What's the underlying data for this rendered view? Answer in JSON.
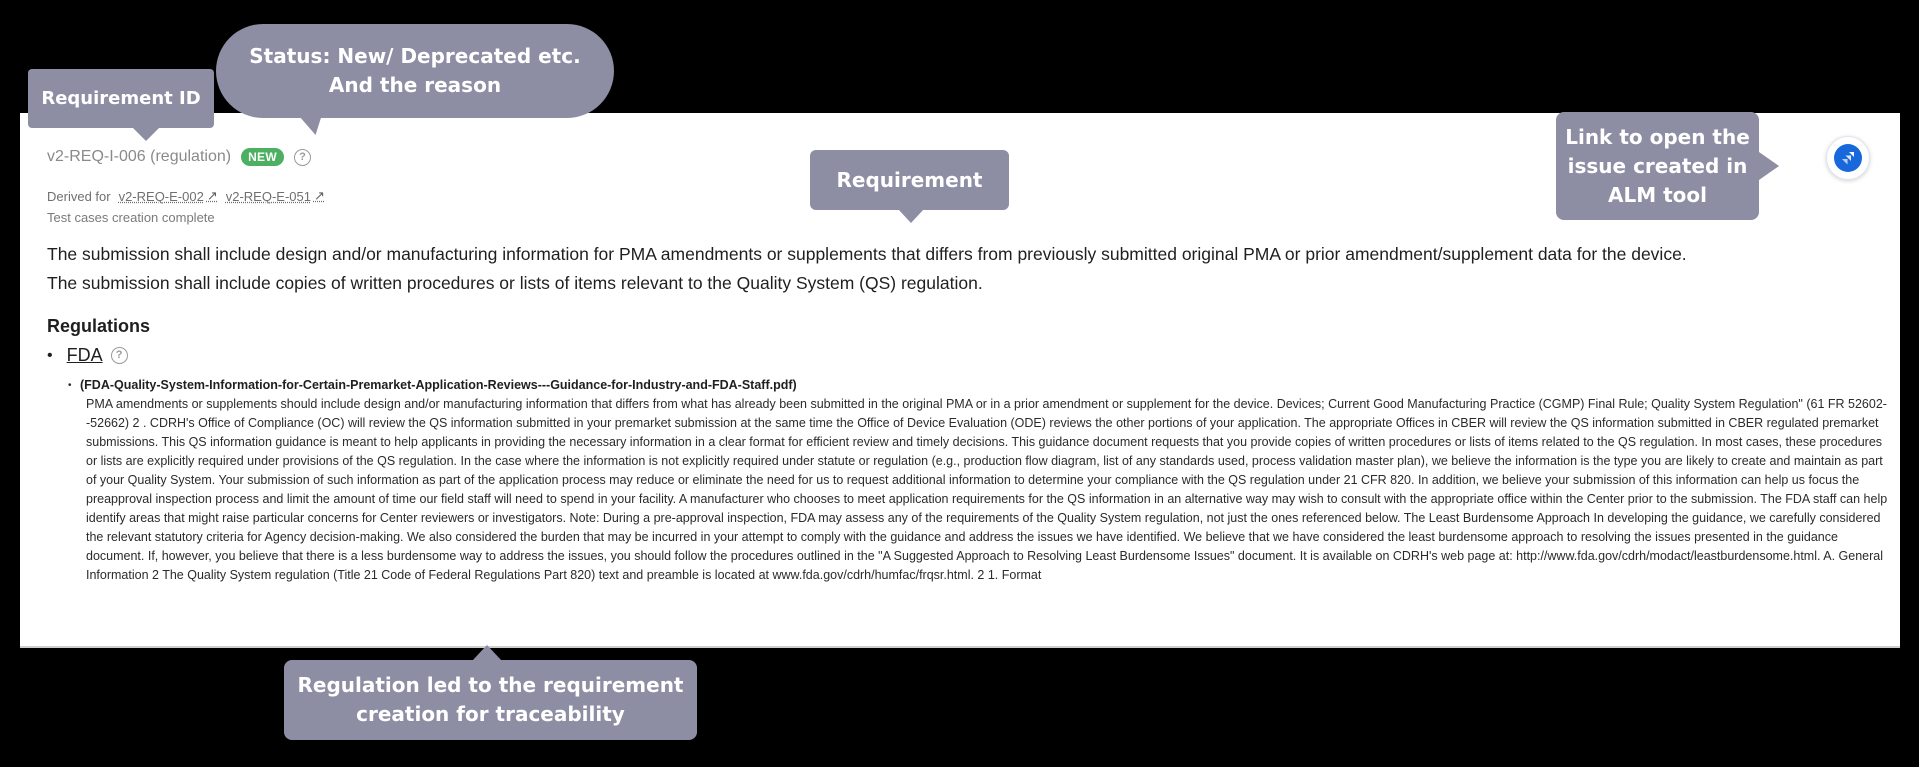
{
  "requirement": {
    "id_label": "v2-REQ-I-006 (regulation)",
    "badge": "NEW",
    "help_glyph": "?",
    "derived_prefix": "Derived for",
    "derived_links": [
      "v2-REQ-E-002",
      "v2-REQ-E-051"
    ],
    "external_link_glyph": "↗",
    "status_line": "Test cases creation complete",
    "text_lines": [
      "The submission shall include design and/or manufacturing information for PMA amendments or supplements that differs from previously submitted original PMA or prior amendment/supplement data for the device.",
      "The submission shall include copies of written procedures or lists of items relevant to the Quality System (QS) regulation."
    ],
    "alm_button_icon": "jira-logo-icon"
  },
  "regulations": {
    "heading": "Regulations",
    "bullet": "•",
    "source_link": "FDA",
    "document": {
      "title": "(FDA-Quality-System-Information-for-Certain-Premarket-Application-Reviews---Guidance-for-Industry-and-FDA-Staff.pdf)",
      "body": "PMA amendments or supplements should include design and/or manufacturing information that differs from what has already been submitted in the original PMA or in a prior amendment or supplement for the device. Devices; Current Good Manufacturing Practice (CGMP) Final Rule; Quality System Regulation\" (61 FR 52602--52662) 2 . CDRH's Office of Compliance (OC) will review the QS information submitted in your premarket submission at the same time the Office of Device Evaluation (ODE) reviews the other portions of your application. The appropriate Offices in CBER will review the QS information submitted in CBER regulated premarket submissions. This QS information guidance is meant to help applicants in providing the necessary information in a clear format for efficient review and timely decisions. This guidance document requests that you provide copies of written procedures or lists of items related to the QS regulation. In most cases, these procedures or lists are explicitly required under provisions of the QS regulation. In the case where the information is not explicitly required under statute or regulation (e.g., production flow diagram, list of any standards used, process validation master plan), we believe the information is the type you are likely to create and maintain as part of your Quality System. Your submission of such information as part of the application process may reduce or eliminate the need for us to request additional information to determine your compliance with the QS regulation under 21 CFR 820. In addition, we believe your submission of this information can help us focus the preapproval inspection process and limit the amount of time our field staff will need to spend in your facility. A manufacturer who chooses to meet application requirements for the QS information in an alternative way may wish to consult with the appropriate office within the Center prior to the submission. The FDA staff can help identify areas that might raise particular concerns for Center reviewers or investigators. Note: During a pre-approval inspection, FDA may assess any of the requirements of the Quality System regulation, not just the ones referenced below. The Least Burdensome Approach In developing the guidance, we carefully considered the relevant statutory criteria for Agency decision-making. We also considered the burden that may be incurred in your attempt to comply with the guidance and address the issues we have identified. We believe that we have considered the least burdensome approach to resolving the issues presented in the guidance document. If, however, you believe that there is a less burdensome way to address the issues, you should follow the procedures outlined in the \"A Suggested Approach to Resolving Least Burdensome Issues\" document. It is available on CDRH's web page at: http://www.fda.gov/cdrh/modact/leastburdensome.html. A. General Information 2 The Quality System regulation (Title 21 Code of Federal Regulations Part 820) text and preamble is located at www.fda.gov/cdrh/humfac/frqsr.html. 2 1. Format"
    }
  },
  "callouts": {
    "requirement_id": "Requirement ID",
    "status_line1": "Status: New/ Deprecated etc.",
    "status_line2": "And the reason",
    "requirement": "Requirement",
    "link_line1": "Link to open the",
    "link_line2": "issue created  in",
    "link_line3": "ALM tool",
    "regulation_line1": "Regulation led to the requirement",
    "regulation_line2": "creation for traceability"
  },
  "colors": {
    "badge_new": "#4caf62",
    "callout_bg": "#8d8da4",
    "alm_blue": "#1868db"
  }
}
